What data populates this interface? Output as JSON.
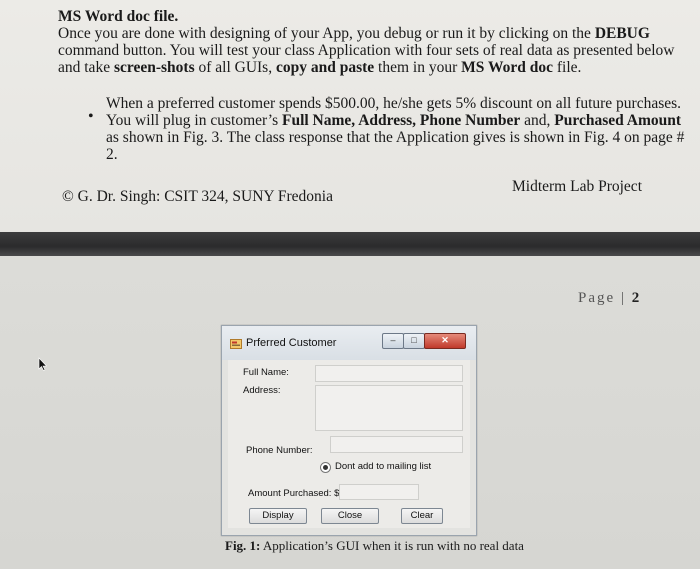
{
  "top_page": {
    "line0": "MS Word doc file.",
    "para1": [
      "Once you are done with designing of your App, you debug or run it by clicking on the ",
      "DEBUG",
      "command button. You will test your class Application with four sets of real data as presented below",
      "and take ",
      "screen-shots",
      " of all GUIs, ",
      "copy and paste",
      " them in your ",
      "MS Word doc",
      " file."
    ],
    "bullet_symbol": "•",
    "bullet": [
      "When a preferred customer spends $500.00, he/she gets 5% discount on all future purchases.",
      "You will plug in customer’s ",
      "Full Name, Address, Phone Number",
      " and, ",
      "Purchased Amount",
      "as shown in Fig. 3. The class response that the Application gives is shown in Fig. 4 on page #",
      "2."
    ],
    "footer_left": "© G. Dr. Singh: CSIT 324, SUNY Fredonia",
    "footer_right": "Midterm Lab Project"
  },
  "bottom_page": {
    "page_word": "Page",
    "page_sep": " | ",
    "page_number": "2",
    "caption_bold": "Fig. 1:",
    "caption_text": " Application’s GUI when it is run with no real data"
  },
  "window": {
    "title": "Prferred Customer",
    "close_glyph": "✕",
    "labels": {
      "full_name": "Full Name:",
      "address": "Address:",
      "phone": "Phone Number:",
      "mailing": "Dont add to mailing list",
      "amount": "Amount Purchased: $"
    },
    "buttons": {
      "display": "Display",
      "close": "Close",
      "clear": "Clear"
    }
  }
}
